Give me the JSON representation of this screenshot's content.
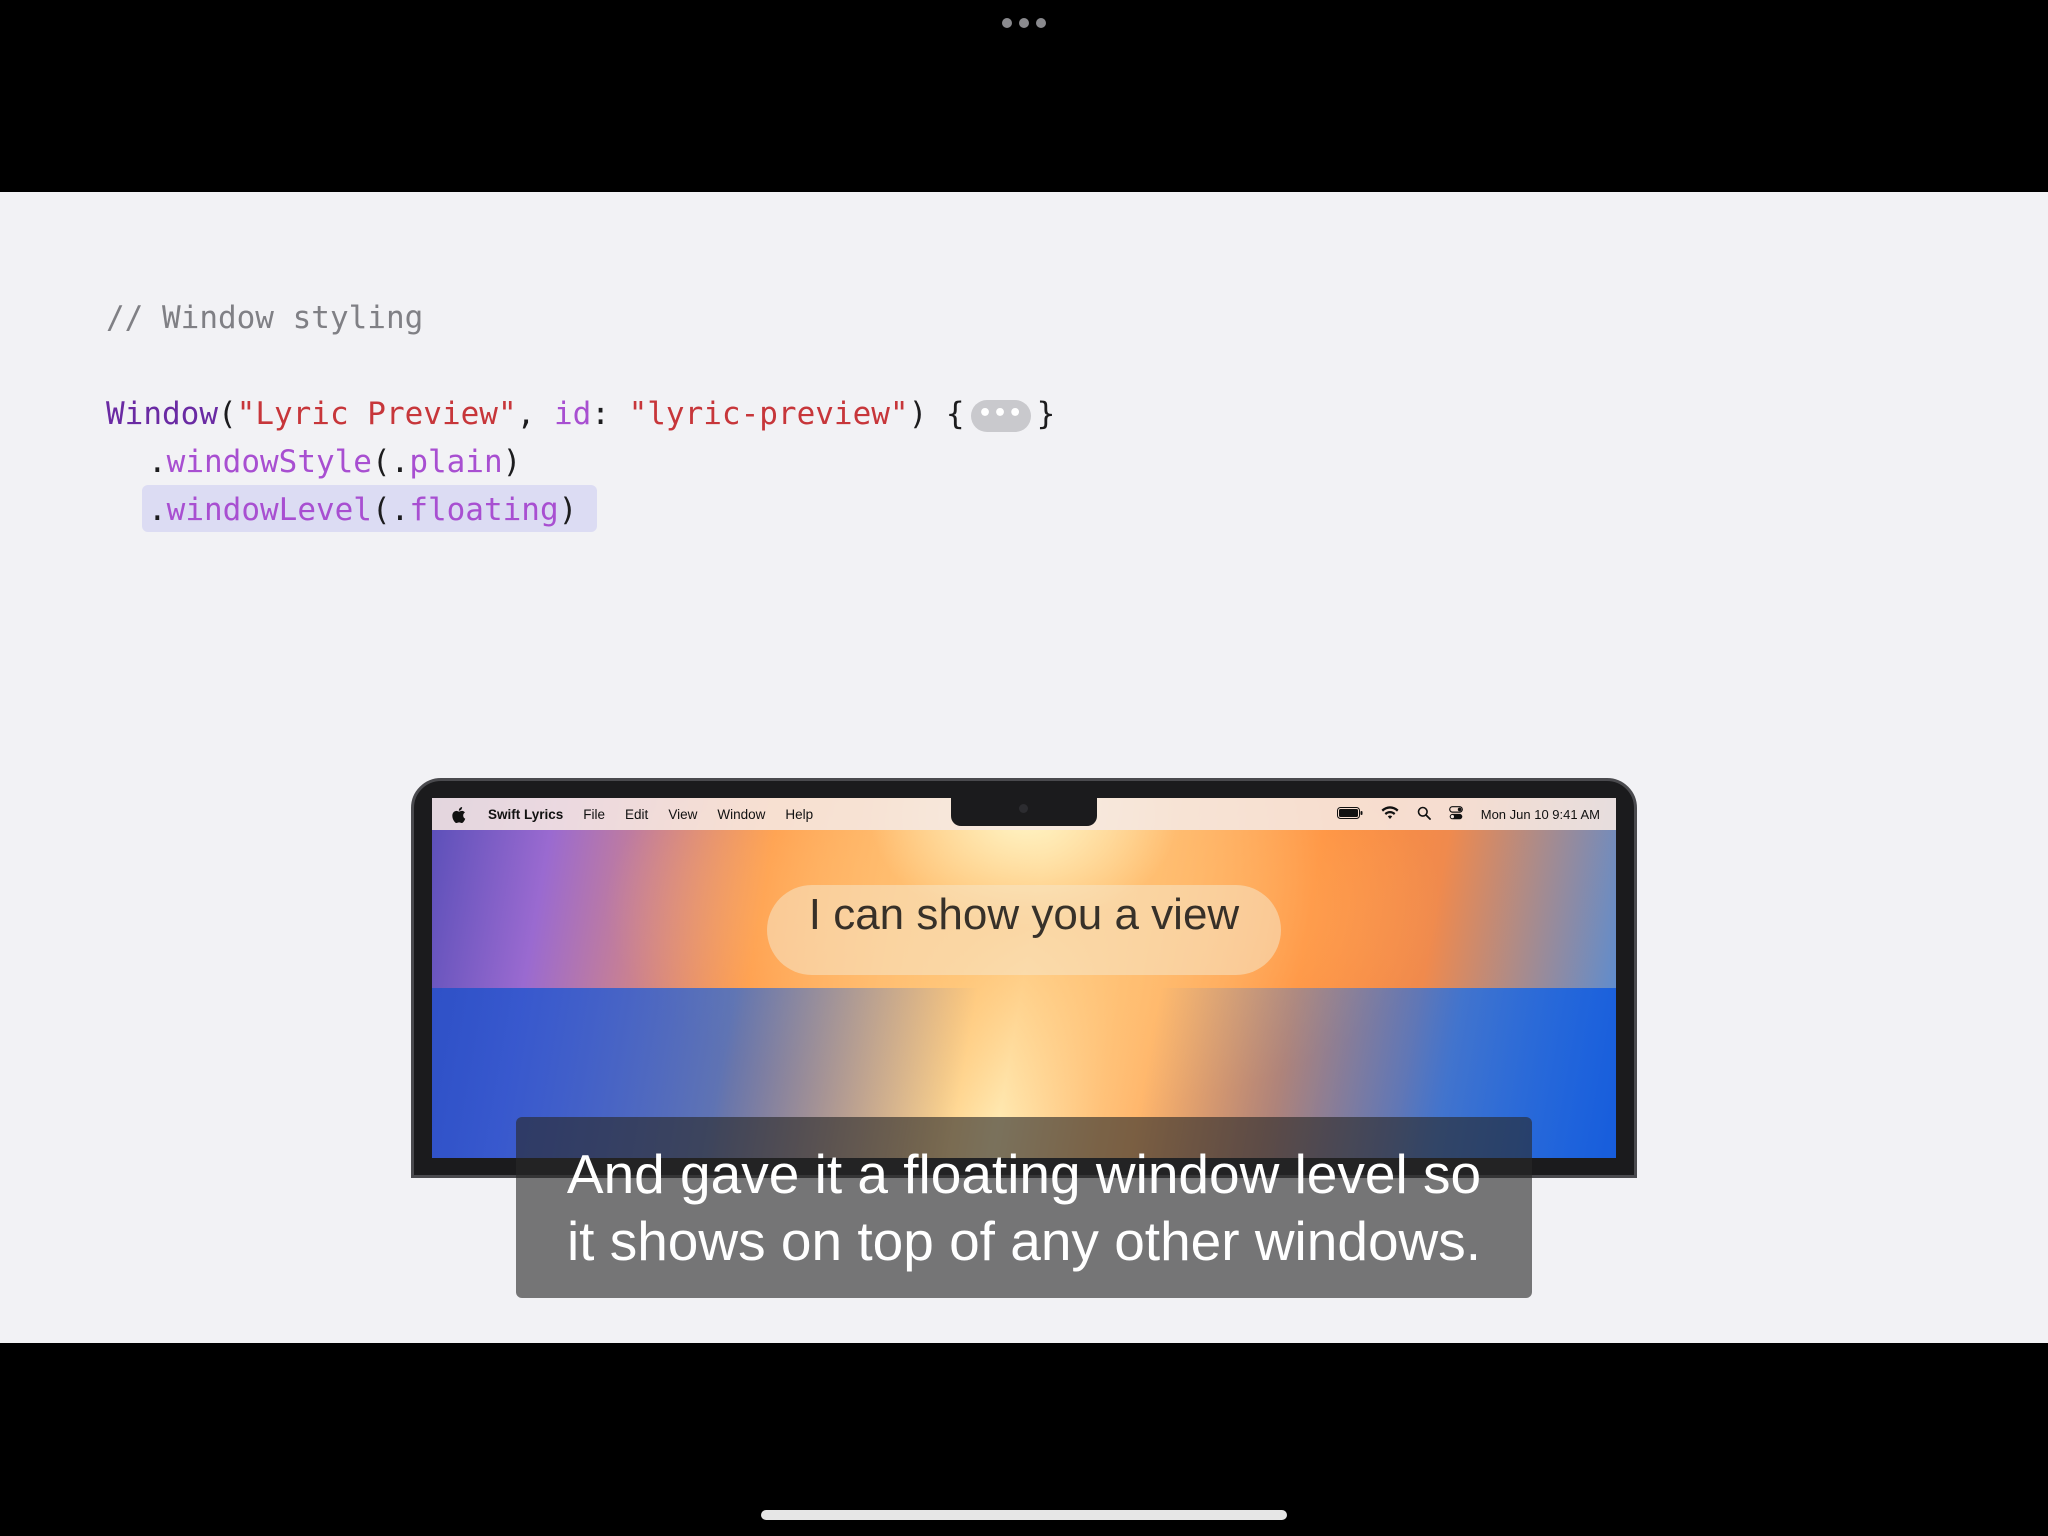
{
  "code": {
    "comment": "// Window styling",
    "line1": {
      "type": "Window",
      "open_paren": "(",
      "title_string": "\"Lyric Preview\"",
      "comma": ", ",
      "label": "id",
      "colon": ": ",
      "id_string": "\"lyric-preview\"",
      "close_paren_brace": ") {",
      "ellipsis": "•••",
      "close_brace": "}"
    },
    "line2": {
      "dot": ".",
      "method": "windowStyle",
      "open": "(.",
      "arg": "plain",
      "close": ")"
    },
    "line3": {
      "dot": ".",
      "method": "windowLevel",
      "open": "(.",
      "arg": "floating",
      "close": ")"
    }
  },
  "mac": {
    "menu": {
      "app_name": "Swift Lyrics",
      "items": [
        "File",
        "Edit",
        "View",
        "Window",
        "Help"
      ]
    },
    "status": {
      "datetime": "Mon Jun 10  9:41 AM"
    },
    "lyric": "I can show you a view"
  },
  "caption": {
    "line1": "And gave it a floating window level so",
    "line2": "it shows on top of any other windows."
  },
  "icons": [
    "apple-icon",
    "battery-icon",
    "wifi-icon",
    "search-icon",
    "control-center-icon",
    "more-dots-icon"
  ]
}
